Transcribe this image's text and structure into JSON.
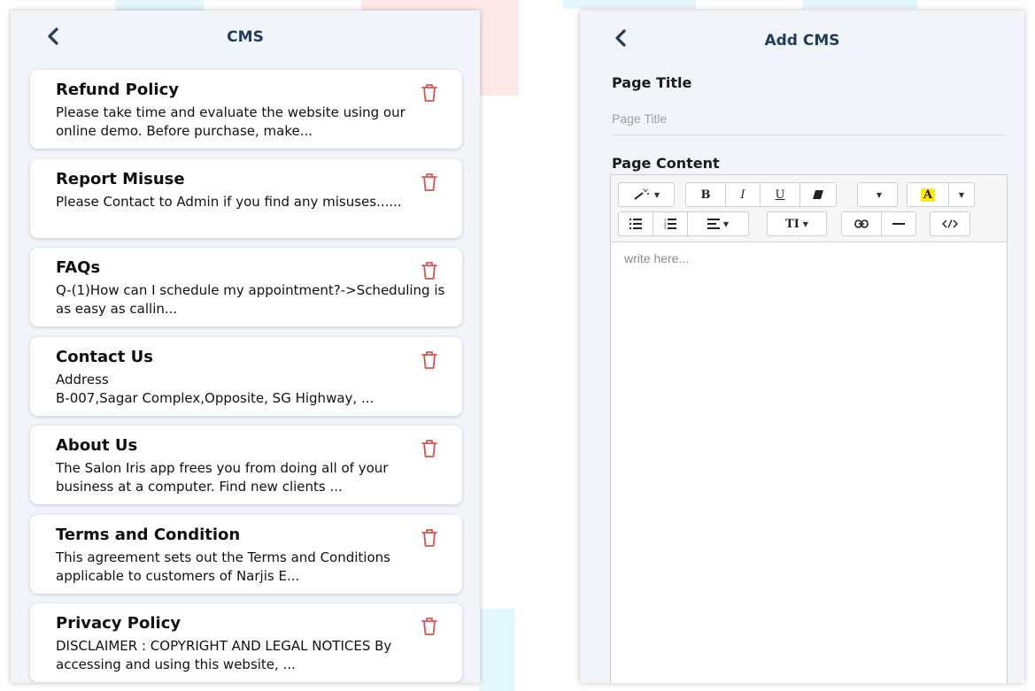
{
  "left_screen": {
    "title": "CMS",
    "items": [
      {
        "title": "Refund Policy",
        "description": "Please take time and evaluate the website using our online demo. Before purchase, make..."
      },
      {
        "title": "Report Misuse",
        "description": "Please Contact to Admin if you find any misuses......"
      },
      {
        "title": "FAQs",
        "description": "Q-(1)How can I schedule my appointment?->Scheduling is as easy as callin..."
      },
      {
        "title": "Contact Us",
        "description": "Address\n B-007,Sagar Complex,Opposite, SG Highway, ..."
      },
      {
        "title": "About Us",
        "description": "The Salon Iris app frees you from doing all of your business at a computer. Find new clients ..."
      },
      {
        "title": "Terms and Condition",
        "description": "This agreement sets out the Terms and Conditions applicable to customers of Narjis E..."
      },
      {
        "title": "Privacy Policy",
        "description": "DISCLAIMER : COPYRIGHT AND LEGAL NOTICES By accessing and using this website, ..."
      }
    ]
  },
  "right_screen": {
    "title": "Add CMS",
    "page_title_label": "Page Title",
    "page_title_placeholder": "Page Title",
    "page_content_label": "Page Content",
    "editor_placeholder": "write here...",
    "toolbar": {
      "bold": "B",
      "italic": "I",
      "underline": "U",
      "highlight": "A",
      "text_size": "TI"
    }
  },
  "colors": {
    "header_text": "#1f3c5a",
    "back_arrow": "#1f3c5a",
    "delete_icon": "#d9534f",
    "screen_background": "#f1f5f9"
  }
}
